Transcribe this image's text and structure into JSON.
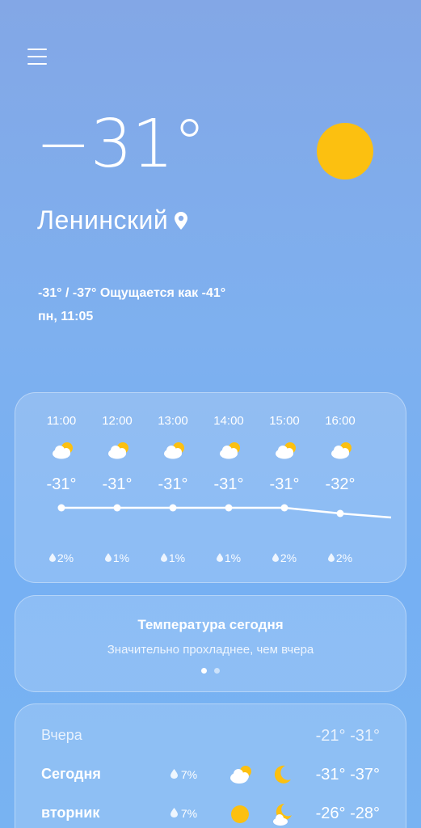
{
  "header": {
    "menu_icon": "hamburger-menu-icon"
  },
  "current": {
    "temperature": "−31°",
    "location": "Ленинский",
    "location_icon": "location-pin-icon",
    "condition_icon": "sun-icon",
    "hi_lo_feels": "-31° / -37° Ощущается как -41°",
    "datetime": "пн, 11:05"
  },
  "hourly": {
    "items": [
      {
        "time": "11:00",
        "icon": "partly-cloudy-day-icon",
        "temp": "-31°",
        "temp_value": -31,
        "precip": "2%"
      },
      {
        "time": "12:00",
        "icon": "partly-cloudy-day-icon",
        "temp": "-31°",
        "temp_value": -31,
        "precip": "1%"
      },
      {
        "time": "13:00",
        "icon": "partly-cloudy-day-icon",
        "temp": "-31°",
        "temp_value": -31,
        "precip": "1%"
      },
      {
        "time": "14:00",
        "icon": "partly-cloudy-day-icon",
        "temp": "-31°",
        "temp_value": -31,
        "precip": "1%"
      },
      {
        "time": "15:00",
        "icon": "partly-cloudy-day-icon",
        "temp": "-31°",
        "temp_value": -31,
        "precip": "2%"
      },
      {
        "time": "16:00",
        "icon": "partly-cloudy-day-icon",
        "temp": "-32°",
        "temp_value": -32,
        "precip": "2%"
      }
    ]
  },
  "summary": {
    "title": "Температура сегодня",
    "subtitle": "Значительно прохладнее, чем вчера",
    "page_index": 0,
    "page_count": 2
  },
  "daily": {
    "rows": [
      {
        "name": "Вчера",
        "precip": "",
        "temps": "-21° -31°",
        "day_icon": "",
        "night_icon": ""
      },
      {
        "name": "Сегодня",
        "precip": "7%",
        "temps": "-31° -37°",
        "day_icon": "partly-cloudy-day-icon",
        "night_icon": "crescent-moon-icon"
      },
      {
        "name": "вторник",
        "precip": "7%",
        "temps": "-26° -28°",
        "day_icon": "sun-icon",
        "night_icon": "partly-cloudy-night-icon"
      }
    ]
  },
  "colors": {
    "sun": "#fcc010",
    "cloud": "#ffffff"
  }
}
